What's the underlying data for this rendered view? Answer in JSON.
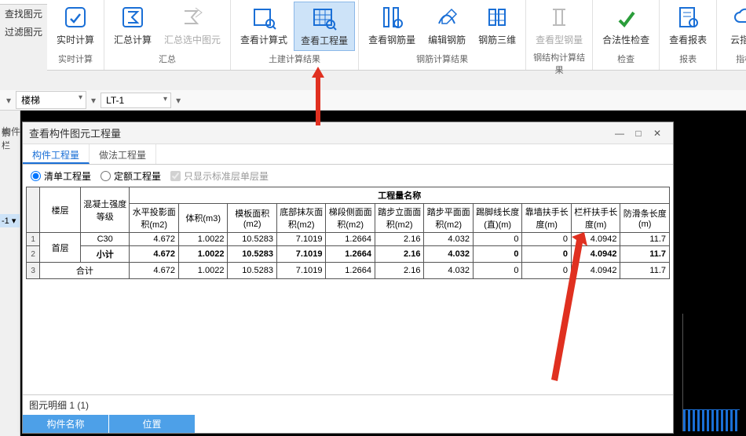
{
  "sidebar": {
    "find": "查找图元",
    "filter": "过滤图元"
  },
  "ribbon": {
    "groups": [
      {
        "label": "实时计算",
        "btns": [
          {
            "n": "rt",
            "l": "实时计算"
          }
        ]
      },
      {
        "label": "汇总",
        "btns": [
          {
            "n": "sum",
            "l": "汇总计算"
          },
          {
            "n": "sumsel",
            "l": "汇总选中图元",
            "d": true
          }
        ]
      },
      {
        "label": "土建计算结果",
        "btns": [
          {
            "n": "vexp",
            "l": "查看计算式"
          },
          {
            "n": "vqty",
            "l": "查看工程量",
            "a": true
          }
        ]
      },
      {
        "label": "钢筋计算结果",
        "btns": [
          {
            "n": "vreb",
            "l": "查看钢筋量"
          },
          {
            "n": "ereb",
            "l": "编辑钢筋"
          },
          {
            "n": "reb3d",
            "l": "钢筋三维"
          }
        ]
      },
      {
        "label": "钢结构计算结果",
        "btns": [
          {
            "n": "vsteel",
            "l": "查看型钢量",
            "d": true
          }
        ]
      },
      {
        "label": "检查",
        "btns": [
          {
            "n": "valid",
            "l": "合法性检查"
          }
        ]
      },
      {
        "label": "报表",
        "btns": [
          {
            "n": "rpt",
            "l": "查看报表"
          }
        ]
      },
      {
        "label": "指标",
        "btns": [
          {
            "n": "cloud",
            "l": "云指标"
          }
        ]
      }
    ]
  },
  "dropdowns": {
    "a": "楼梯",
    "b": "LT-1"
  },
  "leftstrip": {
    "search": "索栏",
    "tag": "-1 ▾"
  },
  "behind": "构件",
  "modal": {
    "title": "查看构件图元工程量",
    "tabs": [
      "构件工程量",
      "做法工程量"
    ],
    "opt_bill": "清单工程量",
    "opt_quota": "定额工程量",
    "opt_std": "只显示标准层单层量",
    "detail_title": "图元明细  1 (1)",
    "detail_heads": [
      "构件名称",
      "位置"
    ]
  },
  "table": {
    "top_headers": [
      "楼层",
      "混凝土强度等级",
      "工程量名称"
    ],
    "qty_headers": [
      "水平投影面积(m2)",
      "体积(m3)",
      "模板面积(m2)",
      "底部抹灰面积(m2)",
      "梯段侧面面积(m2)",
      "踏步立面面积(m2)",
      "踏步平面面积(m2)",
      "踢脚线长度(直)(m)",
      "靠墙扶手长度(m)",
      "栏杆扶手长度(m)",
      "防滑条长度(m)"
    ],
    "rows": [
      {
        "rn": "1",
        "floor": "首层",
        "grade": "C30",
        "v": [
          "4.672",
          "1.0022",
          "10.5283",
          "7.1019",
          "1.2664",
          "2.16",
          "4.032",
          "0",
          "0",
          "4.0942",
          "11.7"
        ]
      },
      {
        "rn": "2",
        "floor": "",
        "grade": "小计",
        "bold": true,
        "v": [
          "4.672",
          "1.0022",
          "10.5283",
          "7.1019",
          "1.2664",
          "2.16",
          "4.032",
          "0",
          "0",
          "4.0942",
          "11.7"
        ]
      },
      {
        "rn": "3",
        "floor": "合计",
        "grade": "",
        "span": true,
        "v": [
          "4.672",
          "1.0022",
          "10.5283",
          "7.1019",
          "1.2664",
          "2.16",
          "4.032",
          "0",
          "0",
          "4.0942",
          "11.7"
        ]
      }
    ]
  },
  "chart_data": {
    "type": "table",
    "title": "查看构件图元工程量",
    "columns": [
      "楼层",
      "混凝土强度等级",
      "水平投影面积(m2)",
      "体积(m3)",
      "模板面积(m2)",
      "底部抹灰面积(m2)",
      "梯段侧面面积(m2)",
      "踏步立面面积(m2)",
      "踏步平面面积(m2)",
      "踢脚线长度(直)(m)",
      "靠墙扶手长度(m)",
      "栏杆扶手长度(m)",
      "防滑条长度(m)"
    ],
    "rows": [
      [
        "首层",
        "C30",
        4.672,
        1.0022,
        10.5283,
        7.1019,
        1.2664,
        2.16,
        4.032,
        0,
        0,
        4.0942,
        11.7
      ],
      [
        "首层",
        "小计",
        4.672,
        1.0022,
        10.5283,
        7.1019,
        1.2664,
        2.16,
        4.032,
        0,
        0,
        4.0942,
        11.7
      ],
      [
        "合计",
        "",
        4.672,
        1.0022,
        10.5283,
        7.1019,
        1.2664,
        2.16,
        4.032,
        0,
        0,
        4.0942,
        11.7
      ]
    ]
  }
}
